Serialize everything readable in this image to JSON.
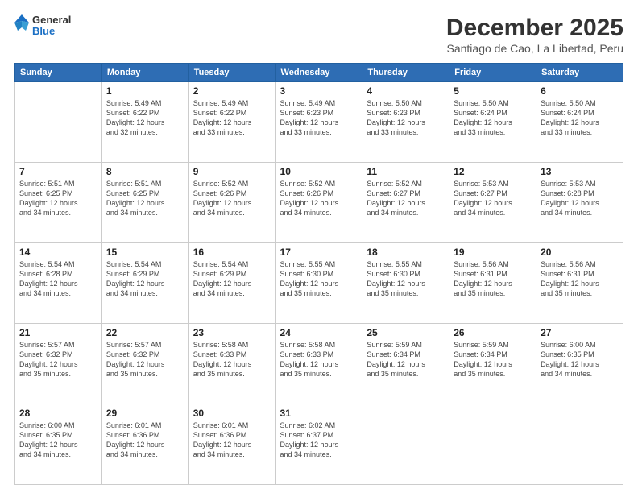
{
  "header": {
    "logo": {
      "line1": "General",
      "line2": "Blue"
    },
    "title": "December 2025",
    "subtitle": "Santiago de Cao, La Libertad, Peru"
  },
  "weekdays": [
    "Sunday",
    "Monday",
    "Tuesday",
    "Wednesday",
    "Thursday",
    "Friday",
    "Saturday"
  ],
  "weeks": [
    [
      {
        "day": "",
        "info": ""
      },
      {
        "day": "1",
        "info": "Sunrise: 5:49 AM\nSunset: 6:22 PM\nDaylight: 12 hours\nand 32 minutes."
      },
      {
        "day": "2",
        "info": "Sunrise: 5:49 AM\nSunset: 6:22 PM\nDaylight: 12 hours\nand 33 minutes."
      },
      {
        "day": "3",
        "info": "Sunrise: 5:49 AM\nSunset: 6:23 PM\nDaylight: 12 hours\nand 33 minutes."
      },
      {
        "day": "4",
        "info": "Sunrise: 5:50 AM\nSunset: 6:23 PM\nDaylight: 12 hours\nand 33 minutes."
      },
      {
        "day": "5",
        "info": "Sunrise: 5:50 AM\nSunset: 6:24 PM\nDaylight: 12 hours\nand 33 minutes."
      },
      {
        "day": "6",
        "info": "Sunrise: 5:50 AM\nSunset: 6:24 PM\nDaylight: 12 hours\nand 33 minutes."
      }
    ],
    [
      {
        "day": "7",
        "info": "Sunrise: 5:51 AM\nSunset: 6:25 PM\nDaylight: 12 hours\nand 34 minutes."
      },
      {
        "day": "8",
        "info": "Sunrise: 5:51 AM\nSunset: 6:25 PM\nDaylight: 12 hours\nand 34 minutes."
      },
      {
        "day": "9",
        "info": "Sunrise: 5:52 AM\nSunset: 6:26 PM\nDaylight: 12 hours\nand 34 minutes."
      },
      {
        "day": "10",
        "info": "Sunrise: 5:52 AM\nSunset: 6:26 PM\nDaylight: 12 hours\nand 34 minutes."
      },
      {
        "day": "11",
        "info": "Sunrise: 5:52 AM\nSunset: 6:27 PM\nDaylight: 12 hours\nand 34 minutes."
      },
      {
        "day": "12",
        "info": "Sunrise: 5:53 AM\nSunset: 6:27 PM\nDaylight: 12 hours\nand 34 minutes."
      },
      {
        "day": "13",
        "info": "Sunrise: 5:53 AM\nSunset: 6:28 PM\nDaylight: 12 hours\nand 34 minutes."
      }
    ],
    [
      {
        "day": "14",
        "info": "Sunrise: 5:54 AM\nSunset: 6:28 PM\nDaylight: 12 hours\nand 34 minutes."
      },
      {
        "day": "15",
        "info": "Sunrise: 5:54 AM\nSunset: 6:29 PM\nDaylight: 12 hours\nand 34 minutes."
      },
      {
        "day": "16",
        "info": "Sunrise: 5:54 AM\nSunset: 6:29 PM\nDaylight: 12 hours\nand 34 minutes."
      },
      {
        "day": "17",
        "info": "Sunrise: 5:55 AM\nSunset: 6:30 PM\nDaylight: 12 hours\nand 35 minutes."
      },
      {
        "day": "18",
        "info": "Sunrise: 5:55 AM\nSunset: 6:30 PM\nDaylight: 12 hours\nand 35 minutes."
      },
      {
        "day": "19",
        "info": "Sunrise: 5:56 AM\nSunset: 6:31 PM\nDaylight: 12 hours\nand 35 minutes."
      },
      {
        "day": "20",
        "info": "Sunrise: 5:56 AM\nSunset: 6:31 PM\nDaylight: 12 hours\nand 35 minutes."
      }
    ],
    [
      {
        "day": "21",
        "info": "Sunrise: 5:57 AM\nSunset: 6:32 PM\nDaylight: 12 hours\nand 35 minutes."
      },
      {
        "day": "22",
        "info": "Sunrise: 5:57 AM\nSunset: 6:32 PM\nDaylight: 12 hours\nand 35 minutes."
      },
      {
        "day": "23",
        "info": "Sunrise: 5:58 AM\nSunset: 6:33 PM\nDaylight: 12 hours\nand 35 minutes."
      },
      {
        "day": "24",
        "info": "Sunrise: 5:58 AM\nSunset: 6:33 PM\nDaylight: 12 hours\nand 35 minutes."
      },
      {
        "day": "25",
        "info": "Sunrise: 5:59 AM\nSunset: 6:34 PM\nDaylight: 12 hours\nand 35 minutes."
      },
      {
        "day": "26",
        "info": "Sunrise: 5:59 AM\nSunset: 6:34 PM\nDaylight: 12 hours\nand 35 minutes."
      },
      {
        "day": "27",
        "info": "Sunrise: 6:00 AM\nSunset: 6:35 PM\nDaylight: 12 hours\nand 34 minutes."
      }
    ],
    [
      {
        "day": "28",
        "info": "Sunrise: 6:00 AM\nSunset: 6:35 PM\nDaylight: 12 hours\nand 34 minutes."
      },
      {
        "day": "29",
        "info": "Sunrise: 6:01 AM\nSunset: 6:36 PM\nDaylight: 12 hours\nand 34 minutes."
      },
      {
        "day": "30",
        "info": "Sunrise: 6:01 AM\nSunset: 6:36 PM\nDaylight: 12 hours\nand 34 minutes."
      },
      {
        "day": "31",
        "info": "Sunrise: 6:02 AM\nSunset: 6:37 PM\nDaylight: 12 hours\nand 34 minutes."
      },
      {
        "day": "",
        "info": ""
      },
      {
        "day": "",
        "info": ""
      },
      {
        "day": "",
        "info": ""
      }
    ]
  ]
}
